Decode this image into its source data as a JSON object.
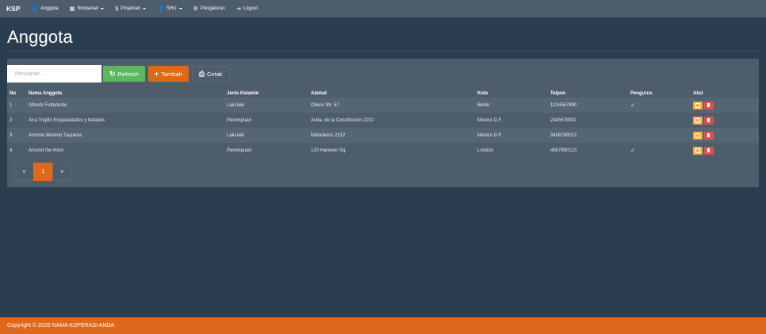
{
  "navbar": {
    "brand": "KSP",
    "items": [
      {
        "label": "Anggota",
        "icon": "user-icon",
        "glyph": "👤",
        "caret": false
      },
      {
        "label": "Simpanan",
        "icon": "grid-icon",
        "glyph": "▦",
        "caret": true
      },
      {
        "label": "Pinjaman",
        "icon": "dollar-icon",
        "glyph": "$",
        "caret": true
      },
      {
        "label": "SHU",
        "icon": "user-icon",
        "glyph": "👤",
        "caret": true
      },
      {
        "label": "Pengaturan",
        "icon": "gear-icon",
        "glyph": "⚙",
        "caret": false
      },
      {
        "label": "Logout",
        "icon": "logout-icon",
        "glyph": "⇥",
        "caret": false
      }
    ]
  },
  "page": {
    "title": "Anggota"
  },
  "toolbar": {
    "search_placeholder": "Pencarian...",
    "refresh_label": "Refresh",
    "tambah_label": "Tambah",
    "cetak_label": "Cetak"
  },
  "table": {
    "headers": [
      "No",
      "Nama Anggota",
      "Jenis Kelamin",
      "Alamat",
      "Kota",
      "Telpon",
      "Pengurus",
      "Aksi"
    ],
    "rows": [
      [
        "1",
        "Alfreds Futterkiste",
        "Laki-laki",
        "Obere Str. 57",
        "Berlin",
        "1234567890",
        "✓"
      ],
      [
        "2",
        "Ana Trujillo Emparedados y helados",
        "Perempuan",
        "Avda. de la Constitucion 2222",
        "Mexico D.F.",
        "2345678901",
        ""
      ],
      [
        "3",
        "Antonio Moreno Taqueria",
        "Laki-laki",
        "Mataderos 2312",
        "Mexico D.F.",
        "3456789012",
        ""
      ],
      [
        "4",
        "Around the Horn",
        "Perempuan",
        "120 Hanover Sq.",
        "London",
        "4567890123",
        "✓"
      ]
    ]
  },
  "pagination": {
    "prev": "«",
    "current": "1",
    "next": "»"
  },
  "footer": {
    "text": "Copyright © 2020 NAMA KOPERASI ANDA"
  },
  "colors": {
    "background": "#2b3e50",
    "navbar": "#4e5d6c",
    "accent": "#df691a",
    "success": "#5cb85c",
    "warning": "#f0ad4e",
    "danger": "#d9534f"
  }
}
